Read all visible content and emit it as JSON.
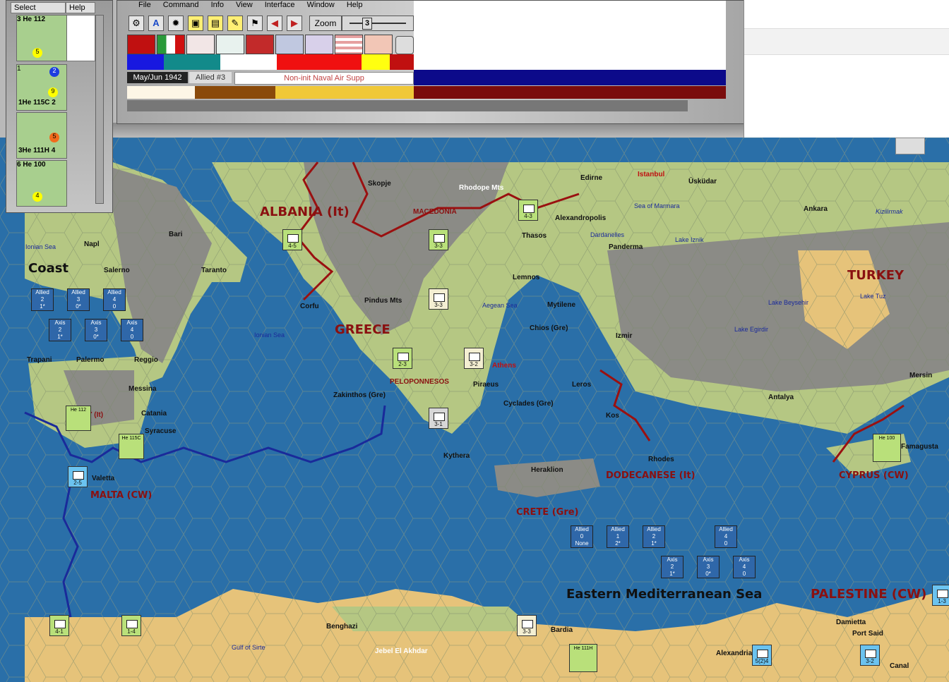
{
  "palette": {
    "menu": [
      "Select",
      "Help"
    ],
    "units": [
      {
        "top": "3 He 112",
        "badge_bottom": "5"
      },
      {
        "top": "1",
        "badge_top": "2",
        "badge_mid": "9",
        "bottom": "1He 115C 2"
      },
      {
        "badge": "5",
        "bottom": "3He 111H 4"
      },
      {
        "top": "6 He 100",
        "badge_bottom": "4"
      }
    ]
  },
  "main_window": {
    "menu": [
      "File",
      "Command",
      "Info",
      "View",
      "Interface",
      "Window",
      "Help"
    ],
    "zoom_label": "Zoom",
    "zoom_value": "3",
    "date": "May/Jun 1942",
    "side": "Allied #3",
    "phase": "Non-init Naval Air Supp"
  },
  "colors": {
    "sea": "#2a6fa8",
    "land": "#c5d98f",
    "mountain": "#8a8a8a",
    "desert": "#e9c97a",
    "border_red": "#9a1010",
    "border_blue": "#1a2a9a"
  },
  "map": {
    "countries": [
      "ALBANIA (It)",
      "GREECE",
      "TURKEY"
    ],
    "regions": [
      "MACEDONIA",
      "PELOPONNESOS",
      "MALTA (CW)",
      "DODECANESE (It)",
      "CRETE (Gre)",
      "CYPRUS (CW)",
      "PALESTINE (CW)",
      "Y (It)"
    ],
    "big_sea": "Eastern Mediterranean Sea",
    "coast": "Coast",
    "cities": [
      "Skopje",
      "Rhodope Mts",
      "Edirne",
      "Istanbul",
      "Üsküdar",
      "Ankara",
      "Kizilirmak",
      "Bari",
      "Napl",
      "Salerno",
      "Taranto",
      "Corfu",
      "Pindus Mts",
      "Thasos",
      "Alexandropolis",
      "Dardanelles",
      "Panderma",
      "Lake Iznik",
      "Sea of Marmara",
      "Lemnos",
      "Mytilene",
      "Chios (Gre)",
      "Izmir",
      "Lake Beysehir",
      "Lake Tuz",
      "Lake Egirdir",
      "Trapani",
      "Palermo",
      "Reggio",
      "Messina",
      "Catania",
      "Syracuse",
      "Zakinthos (Gre)",
      "Piraeus",
      "Athens",
      "Cyclades (Gre)",
      "Leros",
      "Kos",
      "Rhodes",
      "Antalya",
      "Mersin",
      "Kythera",
      "Heraklion",
      "Famagusta",
      "Valetta",
      "Benghazi",
      "Jebel El Akhdar",
      "Bardia",
      "Damietta",
      "Port Said",
      "Alexandria",
      "Canal",
      "Gulf of Sirte",
      "Aegean Sea",
      "Ionian Sea",
      "Ionian Sea"
    ],
    "counters": [
      "4-5",
      "3-3",
      "4-3",
      "3-3",
      "2-3",
      "3-2",
      "3-1",
      "2-5",
      "4-1",
      "1-4",
      "3-3",
      "5(2)4",
      "3-2",
      "1-3"
    ],
    "air_labels": [
      "He 112",
      "He 115C",
      "He 100",
      "He 111H"
    ],
    "naval_boxes_west": [
      {
        "side": "Allied",
        "num": "2",
        "val": "1*"
      },
      {
        "side": "Allied",
        "num": "3",
        "val": "0*"
      },
      {
        "side": "Allied",
        "num": "4",
        "val": "0"
      },
      {
        "side": "Axis",
        "num": "2",
        "val": "1*"
      },
      {
        "side": "Axis",
        "num": "3",
        "val": "0*"
      },
      {
        "side": "Axis",
        "num": "4",
        "val": "0"
      }
    ],
    "naval_boxes_east": [
      {
        "side": "Allied",
        "num": "0",
        "val": "None"
      },
      {
        "side": "Allied",
        "num": "1",
        "val": "2*"
      },
      {
        "side": "Allied",
        "num": "2",
        "val": "1*"
      },
      {
        "side": "Allied",
        "num": "4",
        "val": "0"
      },
      {
        "side": "Axis",
        "num": "2",
        "val": "1*"
      },
      {
        "side": "Axis",
        "num": "3",
        "val": "0*"
      },
      {
        "side": "Axis",
        "num": "4",
        "val": "0"
      }
    ]
  }
}
